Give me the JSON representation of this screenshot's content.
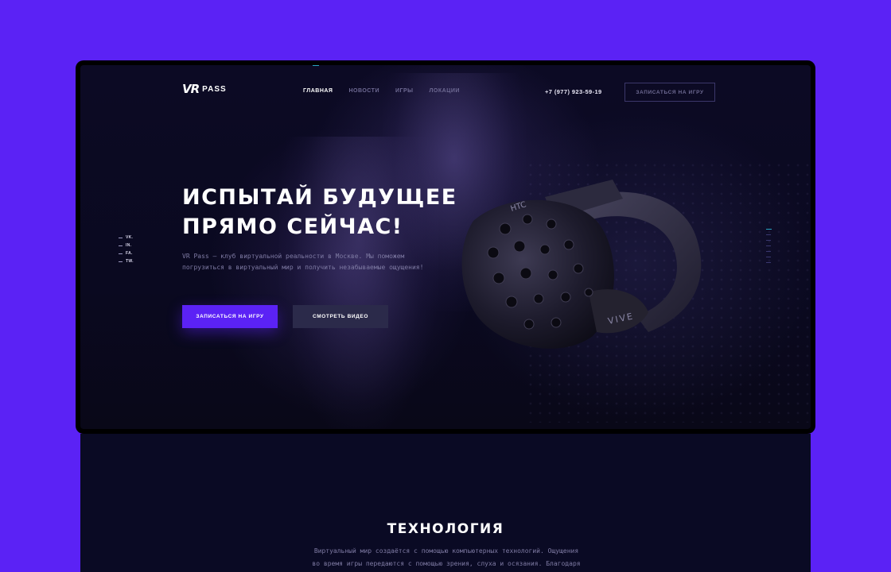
{
  "brand": {
    "logo_vr": "VR",
    "logo_pass": "PASS"
  },
  "nav": {
    "items": [
      {
        "label": "ГЛАВНАЯ",
        "active": true
      },
      {
        "label": "НОВОСТИ",
        "active": false
      },
      {
        "label": "ИГРЫ",
        "active": false
      },
      {
        "label": "ЛОКАЦИИ",
        "active": false
      }
    ],
    "phone": "+7 (977) 923-59-19",
    "cta_label": "ЗАПИСАТЬСЯ НА ИГРУ"
  },
  "socials": [
    {
      "label": "VK.",
      "icon": "dash-icon"
    },
    {
      "label": "IN.",
      "icon": "dash-icon"
    },
    {
      "label": "FA.",
      "icon": "dash-icon"
    },
    {
      "label": "TW.",
      "icon": "dash-icon"
    }
  ],
  "slider": {
    "total": 7,
    "active_index": 0
  },
  "hero": {
    "title_line1": "ИСПЫТАЙ БУДУЩЕЕ",
    "title_line2": "ПРЯМО СЕЙЧАС!",
    "description": "VR Pass — клуб виртуальной реальности в Москве. Мы поможем погрузиться в виртуальный мир и получить незабываемые ощущения!",
    "primary_button": "ЗАПИСАТЬСЯ НА ИГРУ",
    "secondary_button": "СМОТРЕТЬ ВИДЕО",
    "headset_brand": "HTC",
    "headset_model": "VIVE"
  },
  "technology": {
    "title": "ТЕХНОЛОГИЯ",
    "text_line1": "Виртуальный мир создаётся с помощью компьютерных технологий. Ощущения",
    "text_line2": "во время игры передаются с помощью зрения, слуха и осязания. Благодаря"
  },
  "colors": {
    "page_background": "#5b22f5",
    "accent": "#5b22f5",
    "hero_dark": "#0a0920",
    "section_dark": "#0a0a24",
    "indicator": "#29a6c4"
  }
}
